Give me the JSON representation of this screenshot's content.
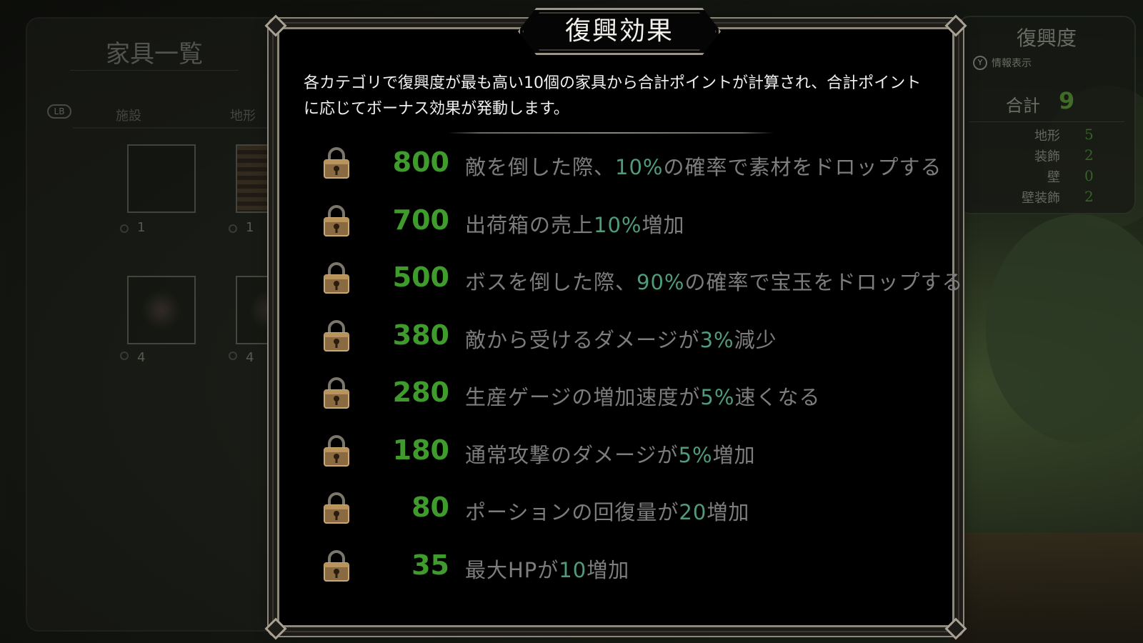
{
  "left_panel": {
    "title": "家具一覧",
    "lb_label": "LB",
    "tabs": [
      "施設",
      "地形"
    ],
    "items": [
      {
        "count": "1"
      },
      {
        "count": "1"
      },
      {
        "count": "4"
      },
      {
        "count": "4"
      }
    ]
  },
  "modal": {
    "title": "復興効果",
    "description": "各カテゴリで復興度が最も高い10個の家具から合計ポイントが計算され、合計ポイントに応じてボーナス効果が発動します。",
    "bonuses": [
      {
        "points": "800",
        "pre": "敵を倒した際、",
        "value": "10%",
        "post": "の確率で素材をドロップする",
        "locked": true
      },
      {
        "points": "700",
        "pre": "出荷箱の売上",
        "value": "10%",
        "post": "増加",
        "locked": true
      },
      {
        "points": "500",
        "pre": "ボスを倒した際、",
        "value": "90%",
        "post": "の確率で宝玉をドロップする",
        "locked": true
      },
      {
        "points": "380",
        "pre": "敵から受けるダメージが",
        "value": "3%",
        "post": "減少",
        "locked": true
      },
      {
        "points": "280",
        "pre": "生産ゲージの増加速度が",
        "value": "5%",
        "post": "速くなる",
        "locked": true
      },
      {
        "points": "180",
        "pre": "通常攻撃のダメージが",
        "value": "5%",
        "post": "増加",
        "locked": true
      },
      {
        "points": "80",
        "pre": "ポーションの回復量が",
        "value": "20",
        "post": "増加",
        "locked": true
      },
      {
        "points": "35",
        "pre": "最大HPが",
        "value": "10",
        "post": "増加",
        "locked": true
      }
    ]
  },
  "right_panel": {
    "title": "復興度",
    "y_label": "Y",
    "info_label": "情報表示",
    "total_label": "合計",
    "total_value": "9",
    "categories": [
      {
        "label": "地形",
        "value": "5"
      },
      {
        "label": "装飾",
        "value": "2"
      },
      {
        "label": "壁",
        "value": "0"
      },
      {
        "label": "壁装飾",
        "value": "2"
      }
    ]
  },
  "colors": {
    "points_green": "#3e9b2c",
    "value_teal": "#4f9b7a",
    "frame": "#8d877a"
  }
}
